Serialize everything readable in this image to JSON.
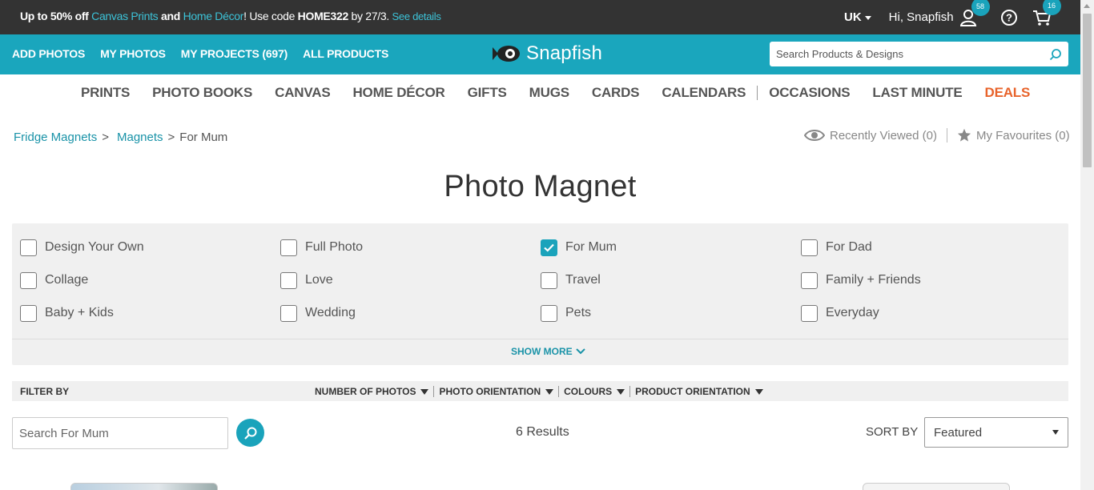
{
  "promo": {
    "part1": "Up to 50% off ",
    "canvas": "Canvas Prints",
    "and": " and ",
    "home": "Home Décor",
    "part2": "! Use code ",
    "code": "HOME322",
    "part3": " by 27/3. ",
    "details": "See details"
  },
  "account": {
    "country": "UK",
    "greeting": "Hi, Snapfish",
    "profile_badge": "58",
    "cart_badge": "16"
  },
  "mainnav": {
    "links": [
      "ADD PHOTOS",
      "MY PHOTOS",
      "MY PROJECTS (697)",
      "ALL PRODUCTS"
    ],
    "logo": "Snapfish",
    "search_placeholder": "Search Products & Designs"
  },
  "categories": [
    "PRINTS",
    "PHOTO BOOKS",
    "CANVAS",
    "HOME DÉCOR",
    "GIFTS",
    "MUGS",
    "CARDS",
    "CALENDARS",
    "OCCASIONS",
    "LAST MINUTE",
    "DEALS"
  ],
  "breadcrumb": {
    "items": [
      "Fridge Magnets",
      "Magnets"
    ],
    "separator": ">",
    "current": "For Mum"
  },
  "recent": {
    "viewed": "Recently Viewed (0)",
    "favourites": "My Favourites (0)"
  },
  "page_title": "Photo Magnet",
  "filters": [
    {
      "label": "Design Your Own",
      "checked": false
    },
    {
      "label": "Full Photo",
      "checked": false
    },
    {
      "label": "For Mum",
      "checked": true
    },
    {
      "label": "For Dad",
      "checked": false
    },
    {
      "label": "Collage",
      "checked": false
    },
    {
      "label": "Love",
      "checked": false
    },
    {
      "label": "Travel",
      "checked": false
    },
    {
      "label": "Family + Friends",
      "checked": false
    },
    {
      "label": "Baby + Kids",
      "checked": false
    },
    {
      "label": "Wedding",
      "checked": false
    },
    {
      "label": "Pets",
      "checked": false
    },
    {
      "label": "Everyday",
      "checked": false
    }
  ],
  "show_more": "SHOW MORE",
  "filter_bar": {
    "label": "FILTER BY",
    "options": [
      "NUMBER OF PHOTOS",
      "PHOTO ORIENTATION",
      "COLOURS",
      "PRODUCT ORIENTATION"
    ]
  },
  "list_search_placeholder": "Search For Mum",
  "results": "6 Results",
  "sort": {
    "label": "SORT BY",
    "selected": "Featured"
  },
  "colors": {
    "teal": "#1aa6bd",
    "promo_bg": "#333333",
    "deals": "#e8642c"
  }
}
